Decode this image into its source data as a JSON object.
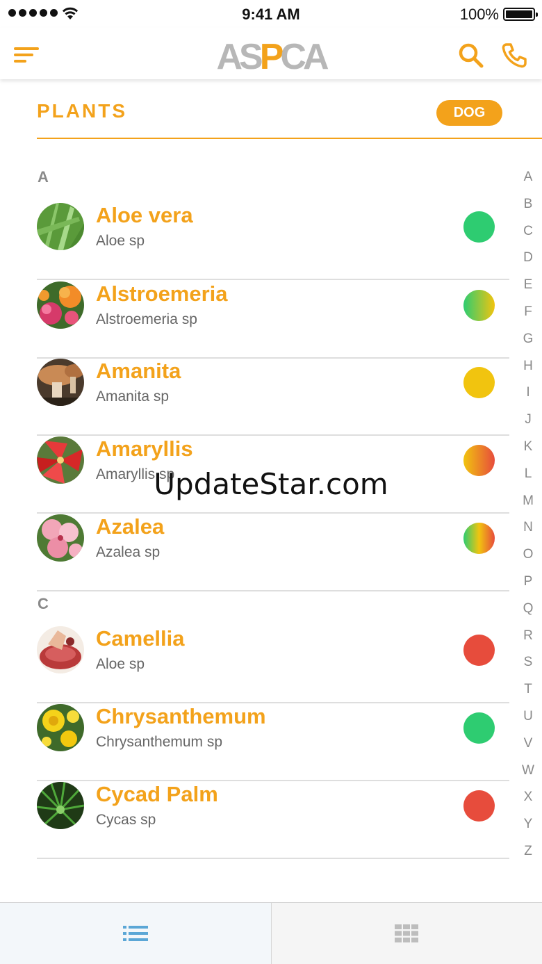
{
  "status_bar": {
    "time": "9:41 AM",
    "battery": "100%"
  },
  "nav": {
    "logo_parts": [
      "AS",
      "P",
      "CA"
    ]
  },
  "section": {
    "title": "PLANTS",
    "filter": "DOG"
  },
  "groups": [
    {
      "letter": "A"
    },
    {
      "letter": "C"
    }
  ],
  "plants": [
    {
      "name": "Aloe vera",
      "scientific": "Aloe sp",
      "toxicity_color": "#2ecc71"
    },
    {
      "name": "Alstroemeria",
      "scientific": "Alstroemeria sp",
      "toxicity_color": "linear-gradient(90deg,#2ecc71,#f1c40f)"
    },
    {
      "name": "Amanita",
      "scientific": "Amanita sp",
      "toxicity_color": "#f1c40f"
    },
    {
      "name": "Amaryllis",
      "scientific": "Amaryllis sp",
      "toxicity_color": "linear-gradient(90deg,#f1c40f,#e74c3c)"
    },
    {
      "name": "Azalea",
      "scientific": "Azalea sp",
      "toxicity_color": "linear-gradient(90deg,#2ecc71,#f1c40f,#e74c3c)"
    },
    {
      "name": "Camellia",
      "scientific": "Aloe sp",
      "toxicity_color": "#e74c3c"
    },
    {
      "name": "Chrysanthemum",
      "scientific": "Chrysanthemum sp",
      "toxicity_color": "#2ecc71"
    },
    {
      "name": "Cycad Palm",
      "scientific": "Cycas sp",
      "toxicity_color": "#e74c3c"
    }
  ],
  "alphabet": [
    "A",
    "B",
    "C",
    "D",
    "E",
    "F",
    "G",
    "H",
    "I",
    "J",
    "K",
    "L",
    "M",
    "N",
    "O",
    "P",
    "Q",
    "R",
    "S",
    "T",
    "U",
    "V",
    "W",
    "X",
    "Y",
    "Z"
  ],
  "watermark": "UpdateStar.com",
  "colors": {
    "accent": "#f3a21b",
    "list_icon": "#5ba7d6"
  }
}
